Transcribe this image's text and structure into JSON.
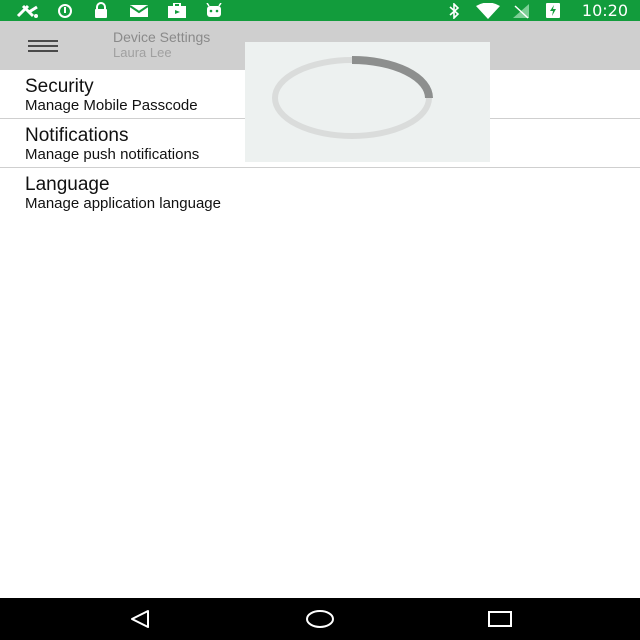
{
  "status_bar": {
    "time": "10:20",
    "left_icons": [
      "satellite-icon",
      "sync-icon",
      "lock-icon",
      "mail-icon",
      "briefcase-icon",
      "android-icon"
    ],
    "right_icons": [
      "bluetooth-icon",
      "wifi-icon",
      "signal-icon",
      "battery-charging-icon"
    ],
    "background": "#129c3c"
  },
  "toolbar": {
    "title": "Device Settings",
    "subtitle": "Laura Lee",
    "menu_icon": "hamburger-icon"
  },
  "settings": {
    "items": [
      {
        "title": "Security",
        "subtitle": "Manage Mobile Passcode"
      },
      {
        "title": "Notifications",
        "subtitle": "Manage push notifications"
      },
      {
        "title": "Language",
        "subtitle": "Manage application language"
      }
    ]
  },
  "loading": {
    "progress": 0.25,
    "track_color": "#dadcdb",
    "arc_color": "#8d8f8e"
  },
  "nav_bar": {
    "buttons": [
      "back-icon",
      "home-icon",
      "recents-icon"
    ]
  }
}
